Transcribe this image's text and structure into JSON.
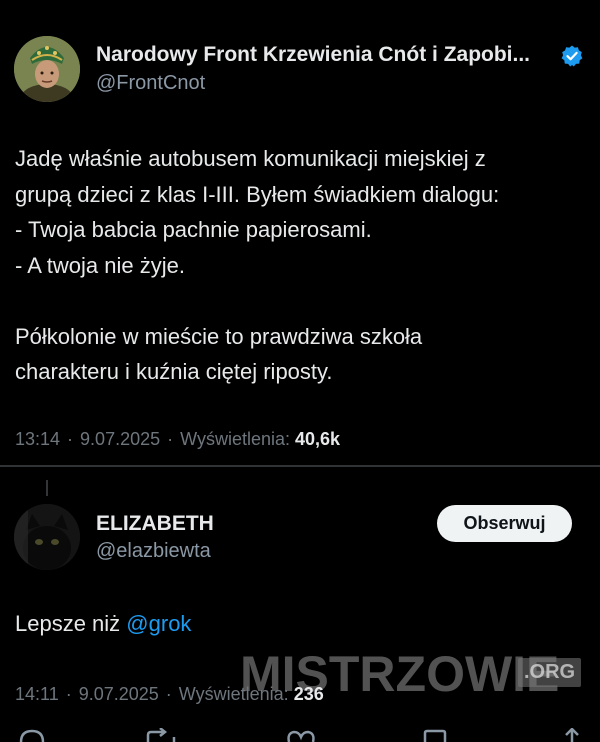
{
  "main_tweet": {
    "display_name": "Narodowy Front Krzewienia Cnót i Zapobi...",
    "handle": "@FrontCnot",
    "text_lines": [
      "Jadę właśnie autobusem komunikacji miejskiej z",
      "grupą dzieci z klas I-III. Byłem świadkiem dialogu:",
      "- Twoja babcia pachnie papierosami.",
      "- A twoja nie żyje.",
      "",
      "Półkolonie w mieście to prawdziwa szkoła",
      "charakteru i kuźnia ciętej riposty."
    ],
    "time": "13:14",
    "date": "9.07.2025",
    "views_label": "Wyświetlenia:",
    "views_count": "40,6k"
  },
  "reply": {
    "display_name": "ELIZABETH",
    "handle": "@elazbiewta",
    "follow_label": "Obserwuj",
    "text_prefix": "Lepsze niż ",
    "mention": "@grok",
    "time": "14:11",
    "date": "9.07.2025",
    "views_label": "Wyświetlenia:",
    "views_count": "236"
  },
  "watermark": {
    "text": "MISTRZOWIE",
    "suffix": ".ORG"
  },
  "colors": {
    "background": "#000000",
    "text": "#e7e9ea",
    "secondary": "#8b98a5",
    "accent": "#1d9bf0",
    "divider": "#2f3336"
  },
  "icons": {
    "verified": "verified-badge-icon",
    "actions": [
      "reply-icon",
      "repost-icon",
      "like-icon",
      "bookmark-icon",
      "share-icon"
    ]
  }
}
